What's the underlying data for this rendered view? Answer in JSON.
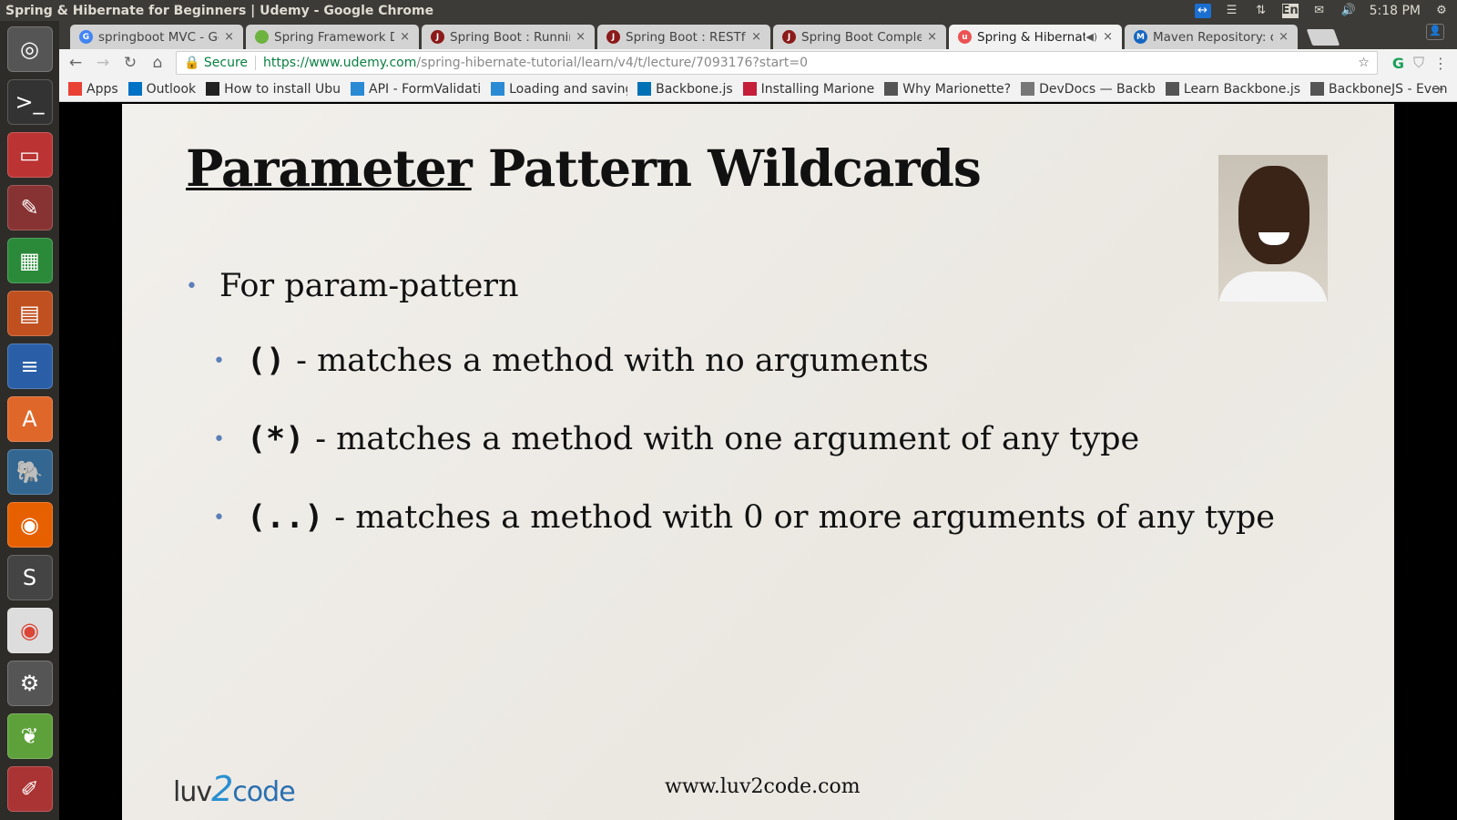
{
  "window": {
    "title": "Spring & Hibernate for Beginners | Udemy - Google Chrome",
    "clock": "5:18 PM",
    "lang": "En"
  },
  "tabs": [
    {
      "label": "springboot MVC - Go",
      "icon": "google-icon",
      "color": "#4285f4",
      "glyph": "G"
    },
    {
      "label": "Spring Framework Do",
      "icon": "spring-icon",
      "color": "#6db33f",
      "glyph": ""
    },
    {
      "label": "Spring Boot : Running",
      "icon": "jb-icon",
      "color": "#8b1a1a",
      "glyph": "J"
    },
    {
      "label": "Spring Boot : RESTful",
      "icon": "jb-icon",
      "color": "#8b1a1a",
      "glyph": "J"
    },
    {
      "label": "Spring Boot Complet",
      "icon": "jb-icon",
      "color": "#8b1a1a",
      "glyph": "J"
    },
    {
      "label": "Spring & Hibernate",
      "icon": "udemy-icon",
      "color": "#ec5252",
      "glyph": "u",
      "active": true
    },
    {
      "label": "Maven Repository: or",
      "icon": "mvn-icon",
      "color": "#1565c0",
      "glyph": "M"
    }
  ],
  "address": {
    "secure": "Secure",
    "scheme_host": "https://www.udemy.com",
    "path": "/spring-hibernate-tutorial/learn/v4/t/lecture/7093176?start=0"
  },
  "bookmarks": [
    {
      "label": "Apps",
      "color": "#e94235"
    },
    {
      "label": "Outlook",
      "color": "#0072c6"
    },
    {
      "label": "How to install Ubu",
      "color": "#222"
    },
    {
      "label": "API - FormValidati",
      "color": "#2a8ad4"
    },
    {
      "label": "Loading and saving",
      "color": "#2a8ad4"
    },
    {
      "label": "Backbone.js",
      "color": "#0071b5"
    },
    {
      "label": "Installing Marione",
      "color": "#c41e3a"
    },
    {
      "label": "Why Marionette?",
      "color": "#555"
    },
    {
      "label": "DevDocs — Backb",
      "color": "#777"
    },
    {
      "label": "Learn Backbone.js",
      "color": "#555"
    },
    {
      "label": "BackboneJS - Even",
      "color": "#555"
    }
  ],
  "slide": {
    "title_underlined": "Parameter",
    "title_rest": " Pattern Wildcards",
    "bullet": "For param-pattern",
    "sub": [
      {
        "code": "()",
        "text": "- matches a method with no arguments"
      },
      {
        "code": "(*)",
        "text": "- matches a method with one argument of any type"
      },
      {
        "code": "(..)",
        "text": "- matches a method with 0 or more arguments of any type"
      }
    ],
    "logo_a": "luv",
    "logo_b": "2",
    "logo_c": "code",
    "site": "www.luv2code.com"
  }
}
